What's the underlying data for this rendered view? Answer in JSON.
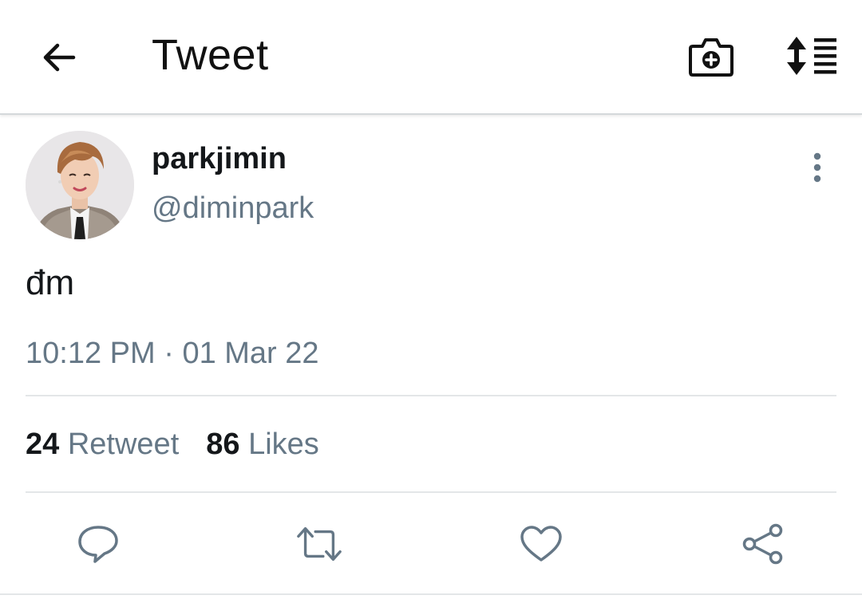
{
  "header": {
    "title": "Tweet",
    "back_icon": "arrow-left-icon",
    "camera_icon": "camera-plus-icon",
    "sort_icon": "sort-list-icon"
  },
  "tweet": {
    "display_name": "parkjimin",
    "handle": "@diminpark",
    "text": "đm",
    "time": "10:12 PM",
    "separator": "·",
    "date": "01 Mar 22",
    "retweet_count": "24",
    "retweet_label": "Retweet",
    "likes_count": "86",
    "likes_label": "Likes"
  },
  "actions": {
    "reply_icon": "reply-icon",
    "retweet_icon": "retweet-icon",
    "like_icon": "heart-icon",
    "share_icon": "share-icon"
  },
  "colors": {
    "primary_text": "#14171a",
    "secondary_text": "#657786",
    "divider": "#e3e6e8"
  }
}
